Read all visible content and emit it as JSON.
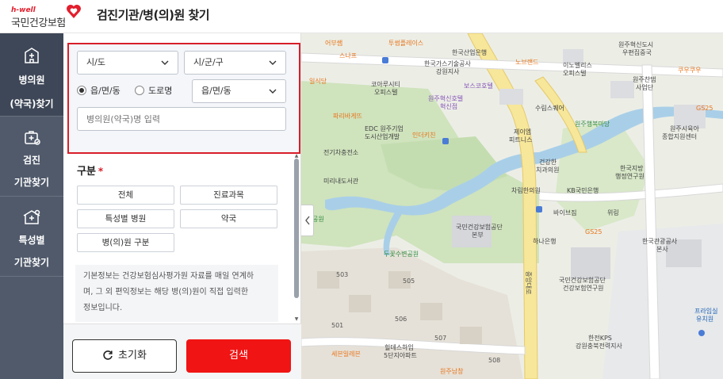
{
  "header": {
    "logo_small": "h-well",
    "logo_main": "국민건강보험",
    "title": "검진기관/병(의)원 찾기"
  },
  "nav": {
    "items": [
      {
        "line1": "병의원",
        "line2": "(약국)찾기",
        "icon": "hospital-icon",
        "active": true
      },
      {
        "line1": "검진",
        "line2": "기관찾기",
        "icon": "checkup-icon",
        "active": false
      },
      {
        "line1": "특성별",
        "line2": "기관찾기",
        "icon": "special-icon",
        "active": false
      }
    ]
  },
  "search": {
    "sido": "시/도",
    "sigungu": "시/군/구",
    "radio_emd": "읍/면/동",
    "radio_road": "도로명",
    "emd_select": "읍/면/동",
    "name_placeholder": "병의원(약국)명 입력"
  },
  "category": {
    "title": "구분",
    "required_mark": "*",
    "buttons": [
      "전체",
      "진료과목",
      "특성별 병원",
      "약국",
      "병(의)원 구분"
    ]
  },
  "info": {
    "text1": "기본정보는 건강보험심사평가원 자료를 매일 연계하",
    "text2": "며, 그 외 편익정보는 해당 병(의)원이 직접 입력한",
    "text3": "정보입니다."
  },
  "actions": {
    "reset": "초기화",
    "search": "검색"
  },
  "colors": {
    "accent_red": "#f01414",
    "nav_bg": "#505a6b",
    "highlight_border": "#d81e2a"
  },
  "map": {
    "labels": [
      {
        "text": "어부쌤",
        "cls": "orange"
      },
      {
        "text": "투썸플레이스",
        "cls": "orange"
      },
      {
        "text": "한국산업은행",
        "cls": ""
      },
      {
        "text": "원주혁신도시",
        "cls": ""
      },
      {
        "text": "우편집중국",
        "cls": ""
      },
      {
        "text": "스나프",
        "cls": "orange"
      },
      {
        "text": "한국가스기술공사",
        "cls": ""
      },
      {
        "text": "강원지사",
        "cls": ""
      },
      {
        "text": "노브랜드",
        "cls": "orange"
      },
      {
        "text": "이노벨리스",
        "cls": ""
      },
      {
        "text": "오피스텔",
        "cls": ""
      },
      {
        "text": "쿠우쿠우",
        "cls": "orange"
      },
      {
        "text": "일식당",
        "cls": "orange"
      },
      {
        "text": "코아루시티",
        "cls": ""
      },
      {
        "text": "오피스텔",
        "cls": ""
      },
      {
        "text": "보스코호텔",
        "cls": "purple"
      },
      {
        "text": "원주찬댐",
        "cls": ""
      },
      {
        "text": "사업단",
        "cls": ""
      },
      {
        "text": "원주혁신호텔",
        "cls": "purple"
      },
      {
        "text": "혁신점",
        "cls": "purple"
      },
      {
        "text": "파리바게뜨",
        "cls": "orange"
      },
      {
        "text": "수림스퀘어",
        "cls": ""
      },
      {
        "text": "EDC 원주기업",
        "cls": ""
      },
      {
        "text": "도시산업개발",
        "cls": ""
      },
      {
        "text": "인더키친",
        "cls": "orange"
      },
      {
        "text": "제이엠",
        "cls": ""
      },
      {
        "text": "피트니스",
        "cls": ""
      },
      {
        "text": "원주행복마당",
        "cls": "green"
      },
      {
        "text": "원주시육아",
        "cls": ""
      },
      {
        "text": "종합지원센터",
        "cls": ""
      },
      {
        "text": "전기차충전소",
        "cls": ""
      },
      {
        "text": "건강한",
        "cls": ""
      },
      {
        "text": "치과의원",
        "cls": ""
      },
      {
        "text": "한국지방",
        "cls": ""
      },
      {
        "text": "행정연구원",
        "cls": ""
      },
      {
        "text": "미리내도서관",
        "cls": ""
      },
      {
        "text": "차림한의원",
        "cls": ""
      },
      {
        "text": "KB국민은행",
        "cls": ""
      },
      {
        "text": "바이브짐",
        "cls": ""
      },
      {
        "text": "위링",
        "cls": ""
      },
      {
        "text": "국민건강보험공단",
        "cls": ""
      },
      {
        "text": "본부",
        "cls": ""
      },
      {
        "text": "하나은행",
        "cls": ""
      },
      {
        "text": "GS25",
        "cls": "orange"
      },
      {
        "text": "한국관광공사",
        "cls": ""
      },
      {
        "text": "본사",
        "cls": ""
      },
      {
        "text": "두꽃수변공원",
        "cls": "green"
      },
      {
        "text": "국민건강보험공단",
        "cls": ""
      },
      {
        "text": "건강보험연구원",
        "cls": ""
      },
      {
        "text": "프라임실",
        "cls": "blue"
      },
      {
        "text": "유치원",
        "cls": "blue"
      },
      {
        "text": "한전KPS",
        "cls": ""
      },
      {
        "text": "강원충북전력지사",
        "cls": ""
      },
      {
        "text": "세븐일레븐",
        "cls": "orange"
      },
      {
        "text": "힐데스하임",
        "cls": ""
      },
      {
        "text": "5단지아파트",
        "cls": ""
      },
      {
        "text": "원주남창",
        "cls": "orange"
      },
      {
        "text": "GS25",
        "cls": "orange"
      },
      {
        "text": "공원",
        "cls": "green"
      }
    ],
    "building_numbers": [
      "503",
      "505",
      "501",
      "506",
      "507",
      "508"
    ]
  }
}
